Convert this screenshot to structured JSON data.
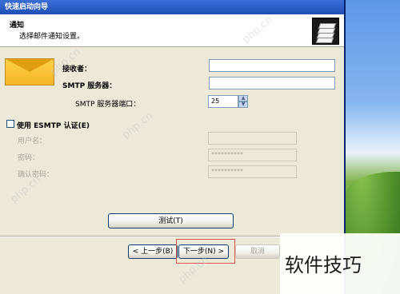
{
  "window": {
    "title": "快速启动向导"
  },
  "header": {
    "title": "通知",
    "subtitle": "选择邮件通知设置。",
    "icon": "server-stack-icon"
  },
  "form": {
    "recipient_label": "接收者：",
    "recipient_value": "",
    "smtp_server_label": "SMTP 服务器：",
    "smtp_server_value": "",
    "smtp_port_label": "SMTP 服务器端口：",
    "smtp_port_value": "25",
    "use_auth_label": "使用 ESMTP 认证(E)",
    "use_auth_checked": false,
    "username_label": "用户名：",
    "username_value": "",
    "password_label": "密码：",
    "password_value": "**********",
    "confirm_password_label": "确认密码：",
    "confirm_password_value": "**********"
  },
  "buttons": {
    "test": "测试(T)",
    "back": "< 上一步(B)",
    "next": "下一步(N) >",
    "cancel": "取消"
  },
  "watermarks": {
    "php_cn": "php.cn",
    "site_text": "软件技巧"
  },
  "colors": {
    "title_bar": "#2d5ec7",
    "window_face": "#ece9d8",
    "highlight_border": "#d9534f",
    "envelope": "#f5b526"
  }
}
